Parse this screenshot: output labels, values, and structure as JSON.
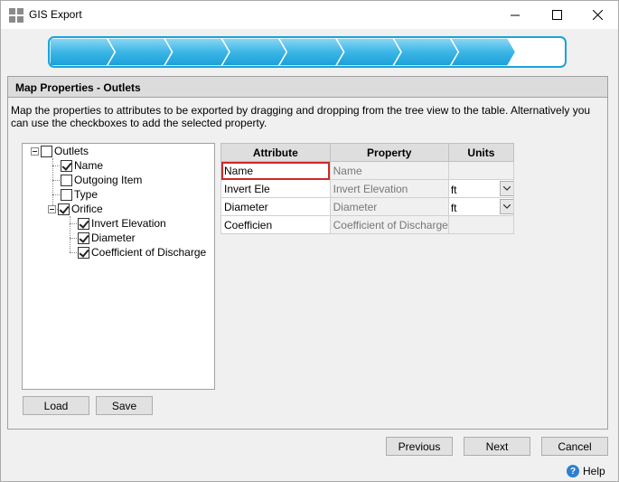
{
  "window": {
    "title": "GIS Export"
  },
  "wizard": {
    "total_steps": 9,
    "completed_steps": 8
  },
  "panel": {
    "title": "Map Properties - Outlets",
    "instructions": "Map the properties to attributes to be exported by dragging and dropping from the tree view to the table. Alternatively you can use the checkboxes to add the selected property."
  },
  "tree": {
    "root": {
      "label": "Outlets",
      "checked": false
    },
    "items": [
      {
        "label": "Name",
        "checked": true
      },
      {
        "label": "Outgoing Item",
        "checked": false
      },
      {
        "label": "Type",
        "checked": false
      },
      {
        "label": "Orifice",
        "checked": true
      },
      {
        "label": "Invert Elevation",
        "checked": true
      },
      {
        "label": "Diameter",
        "checked": true
      },
      {
        "label": "Coefficient of Discharge",
        "checked": true
      }
    ]
  },
  "buttons": {
    "load": "Load",
    "save": "Save",
    "previous": "Previous",
    "next": "Next",
    "cancel": "Cancel",
    "help": "Help"
  },
  "table": {
    "headers": [
      "Attribute",
      "Property",
      "Units"
    ],
    "rows": [
      {
        "attribute": "Name",
        "property": "Name",
        "units": ""
      },
      {
        "attribute": "Invert Ele",
        "property": "Invert Elevation",
        "units": "ft"
      },
      {
        "attribute": "Diameter",
        "property": "Diameter",
        "units": "ft"
      },
      {
        "attribute": "Coefficien",
        "property": "Coefficient of Discharge",
        "units": ""
      }
    ]
  },
  "colors": {
    "accent": "#1aa3dc",
    "selection_border": "#d02828"
  }
}
